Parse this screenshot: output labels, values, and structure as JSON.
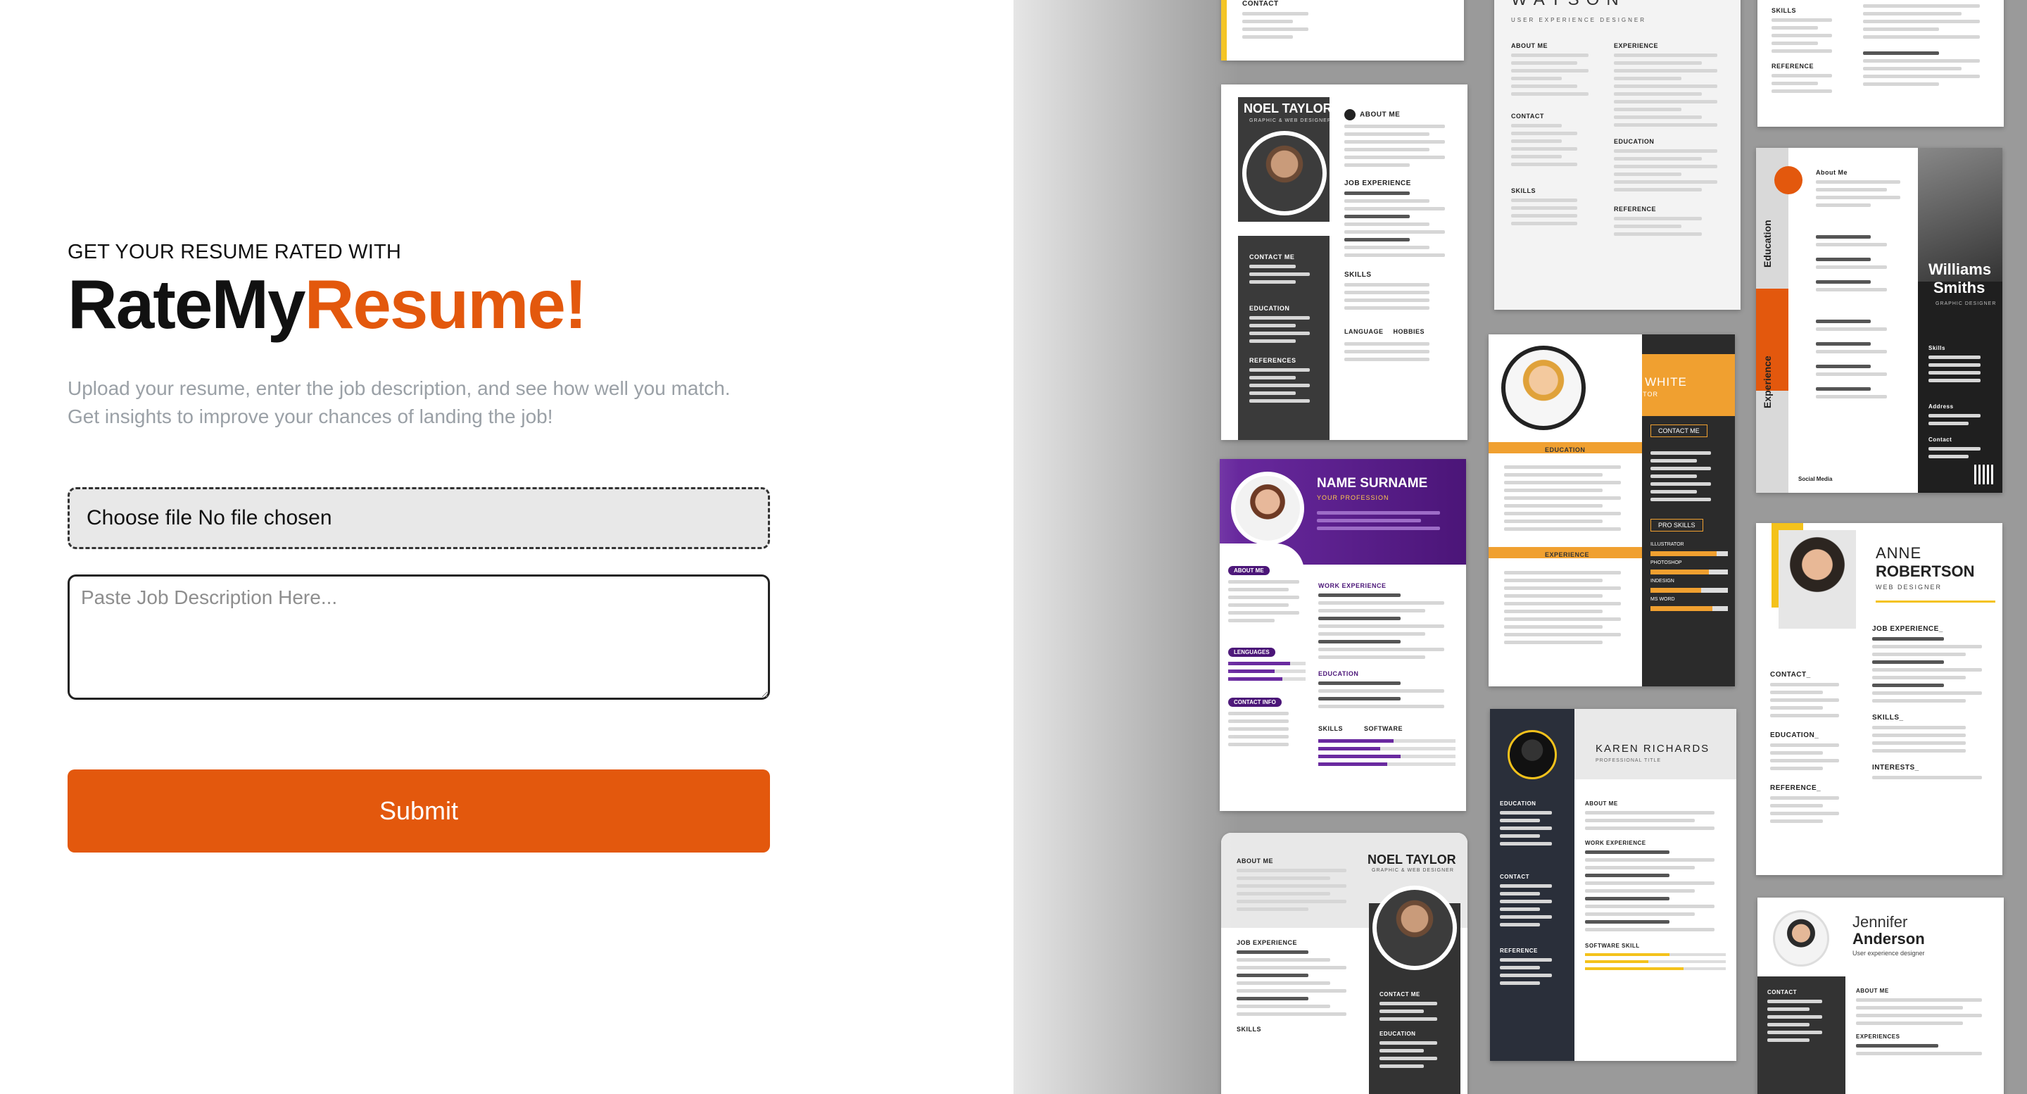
{
  "hero": {
    "kicker": "GET YOUR RESUME RATED WITH",
    "brand_part1": "RateMy",
    "brand_part2": "Resume!",
    "description_line1": "Upload your resume, enter the job description, and see how well you match.",
    "description_line2": "Get insights to improve your chances of landing the job!"
  },
  "form": {
    "file_label": "Choose file No file chosen",
    "job_description_placeholder": "Paste Job Description Here...",
    "submit_label": "Submit"
  },
  "colors": {
    "accent": "#e3580d",
    "purple": "#5b1f8c",
    "amber": "#f0a030",
    "dark": "#2b2b2b"
  },
  "collage": {
    "c1_top": {
      "contact": "CONTACT"
    },
    "c2_watson": {
      "name": "WATSON",
      "title": "USER EXPERIENCE DESIGNER",
      "about": "ABOUT ME",
      "experience": "EXPERIENCE",
      "contact": "CONTACT",
      "education": "EDUCATION",
      "skills": "SKILLS",
      "reference": "REFERENCE"
    },
    "c3_top": {
      "skills": "SKILLS",
      "reference": "REFERENCE"
    },
    "c4_noel": {
      "name": "NOEL TAYLOR",
      "title": "GRAPHIC & WEB DESIGNER",
      "about": "ABOUT ME",
      "job": "JOB EXPERIENCE",
      "contact": "CONTACT ME",
      "education": "EDUCATION",
      "references": "REFERENCES",
      "skills": "SKILLS",
      "language": "LANGUAGE",
      "hobbies": "HOBBIES"
    },
    "c5_kelly": {
      "name": "KELLY WHITE",
      "title": "ART DIRECTOR",
      "contact": "CONTACT ME",
      "education": "EDUCATION",
      "experience": "EXPERIENCE",
      "skills": "PRO SKILLS",
      "skill_list": [
        "ILLUSTRATOR",
        "PHOTOSHOP",
        "INDESIGN",
        "MS WORD"
      ]
    },
    "c6_williams": {
      "name1": "Williams",
      "name2": "Smiths",
      "title": "GRAPHIC DESIGNER",
      "education": "Education",
      "experience": "Experience",
      "skills": "Skills",
      "address": "Address",
      "contact": "Contact",
      "social": "Social Media",
      "about": "About Me"
    },
    "c7_name": {
      "name": "NAME SURNAME",
      "title": "YOUR PROFESSION",
      "about": "ABOUT ME",
      "work": "WORK EXPERIENCE",
      "education": "EDUCATION",
      "languages": "LENGUAGES",
      "contact": "CONTACT INFO",
      "skills": "SKILLS",
      "software": "SOFTWARE"
    },
    "c8_anne": {
      "name1": "ANNE",
      "name2": "ROBERTSON",
      "title": "WEB DESIGNER",
      "job": "JOB EXPERIENCE_",
      "contact": "CONTACT_",
      "education": "EDUCATION_",
      "skills": "SKILLS_",
      "reference": "REFERENCE_",
      "interests": "INTERESTS_"
    },
    "c9_karen": {
      "name": "KAREN RICHARDS",
      "title": "PROFESSIONAL TITLE",
      "education": "EDUCATION",
      "about": "ABOUT ME",
      "work": "WORK EXPERIENCE",
      "contact": "CONTACT",
      "reference": "REFERENCE",
      "software": "SOFTWARE SKILL"
    },
    "c10_noel2": {
      "name": "NOEL TAYLOR",
      "title": "GRAPHIC & WEB DESIGNER",
      "about": "ABOUT ME",
      "job": "JOB EXPERIENCE",
      "contact": "CONTACT ME",
      "education": "EDUCATION",
      "skills": "SKILLS"
    },
    "c11_jennifer": {
      "name1": "Jennifer",
      "name2": "Anderson",
      "title": "User experience designer",
      "contact": "CONTACT",
      "about": "ABOUT ME",
      "experiences": "EXPERIENCES"
    }
  }
}
